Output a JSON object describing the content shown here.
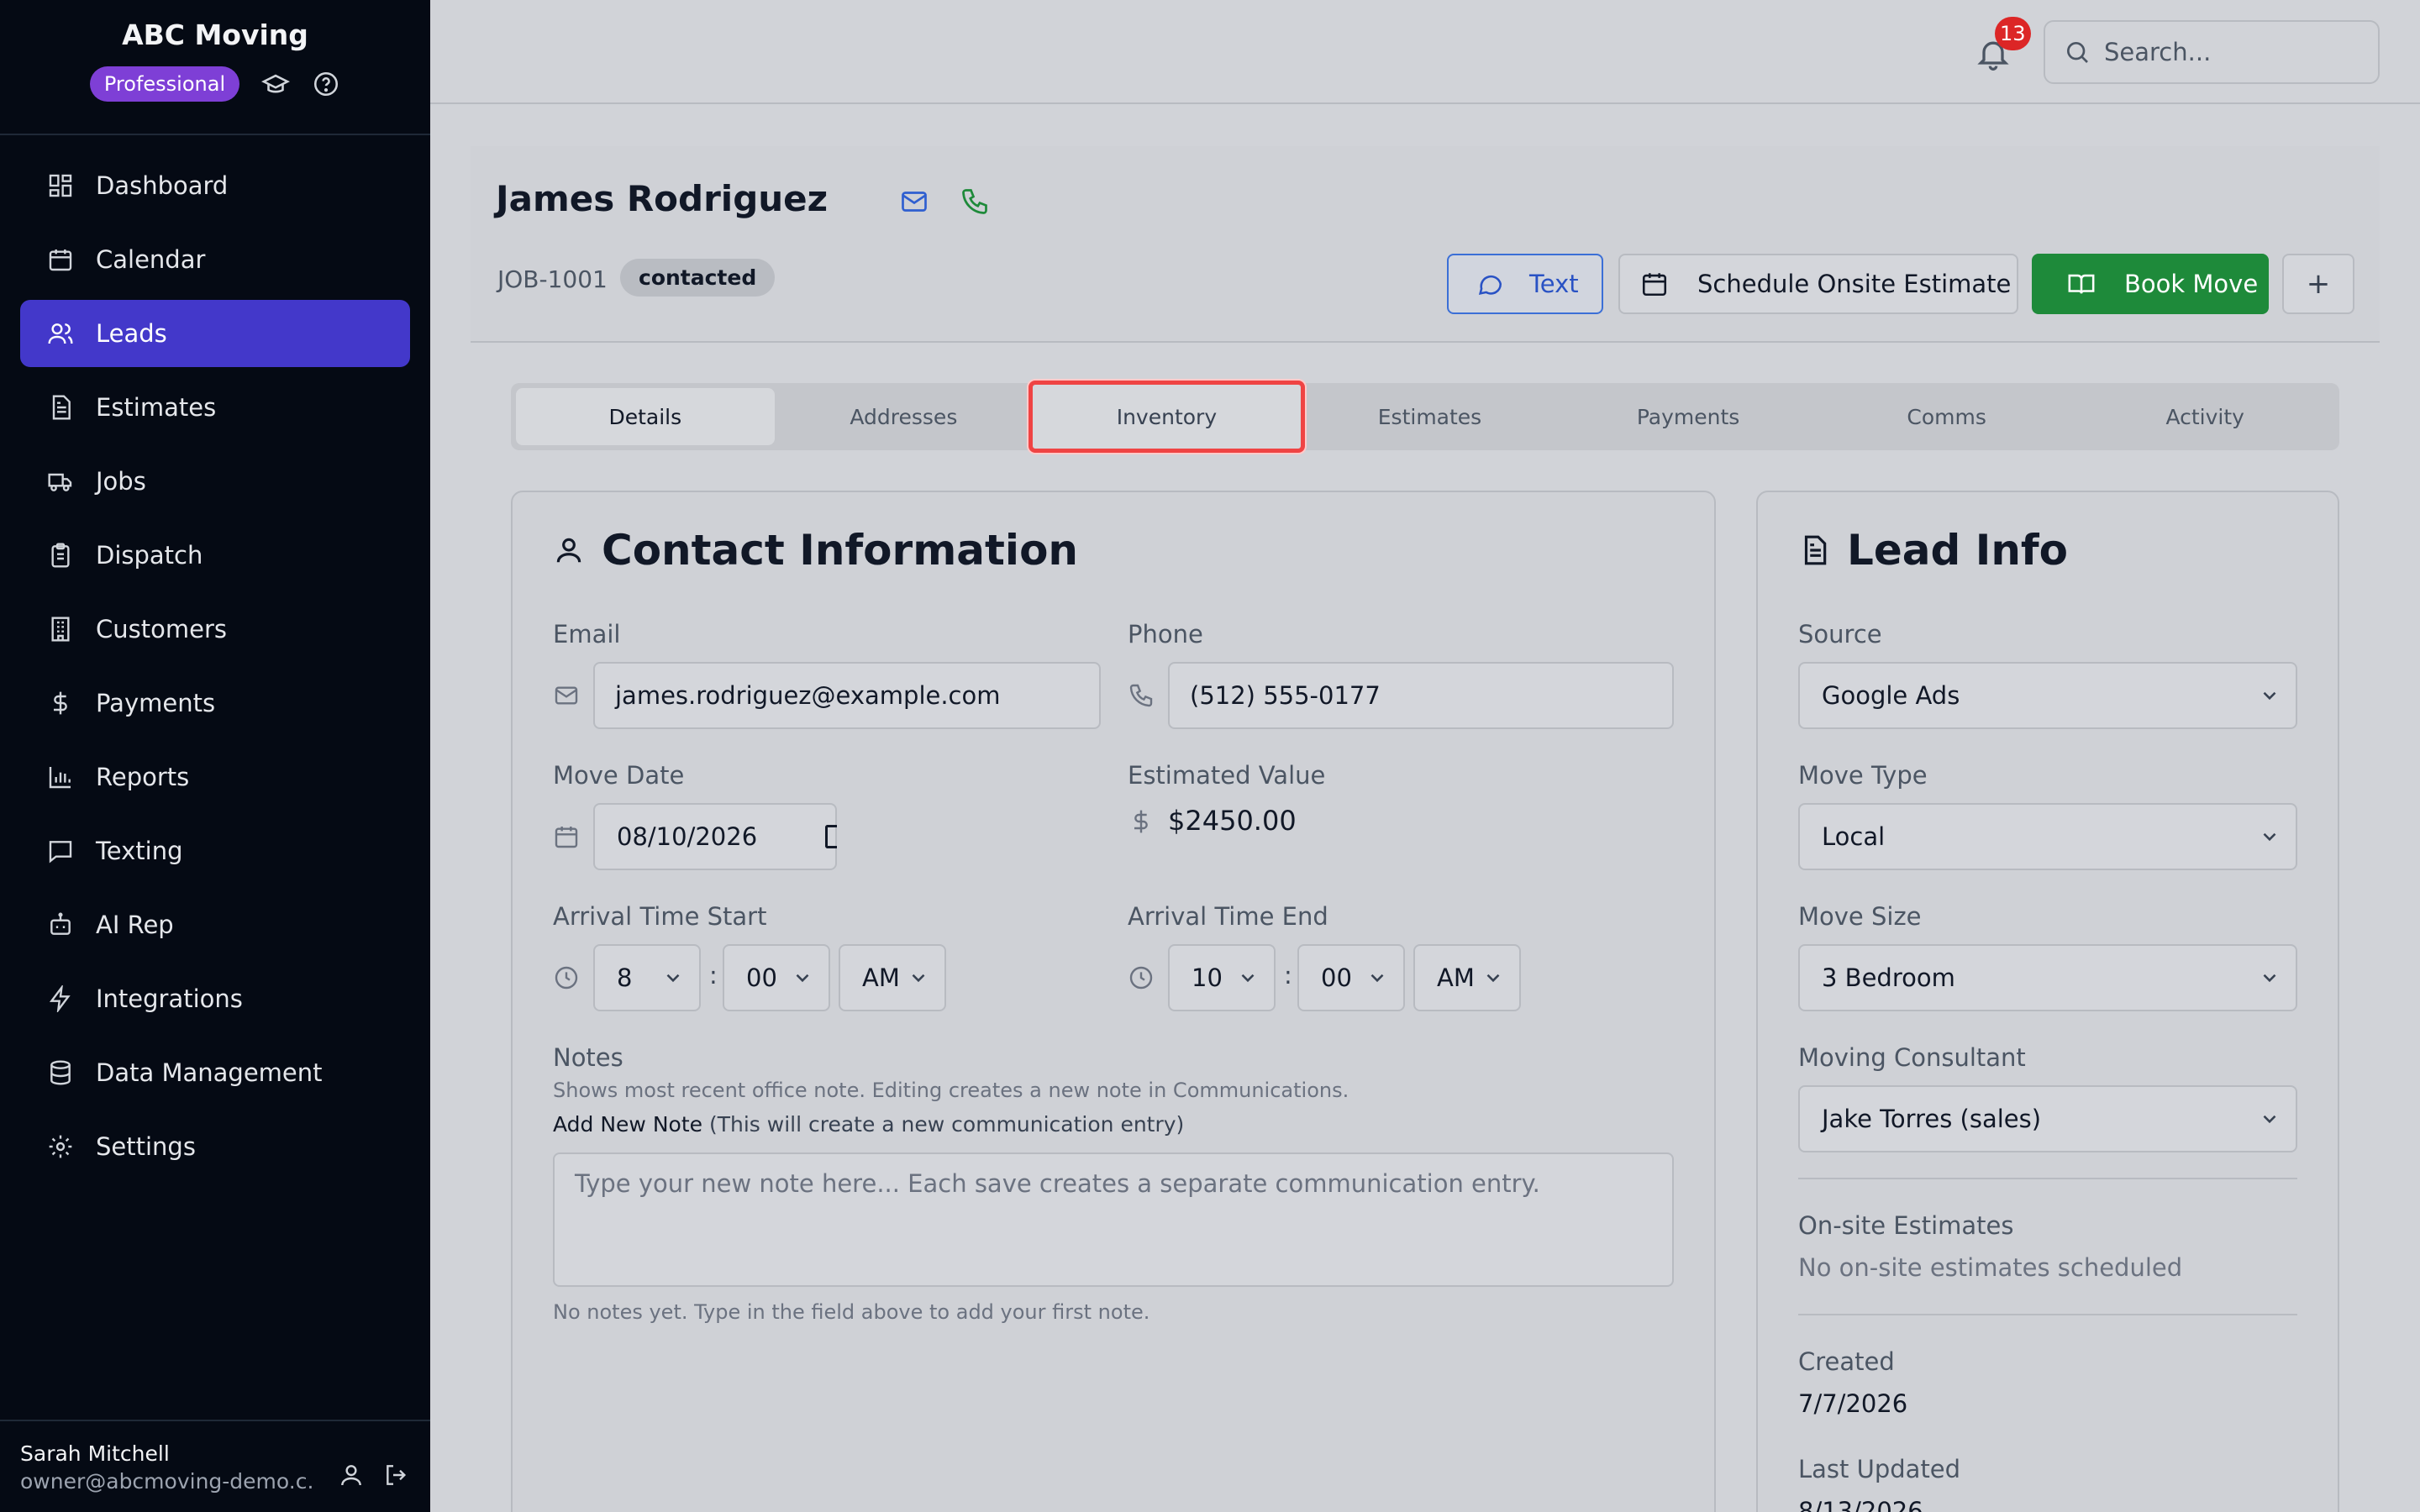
{
  "brand": {
    "name": "ABC Moving",
    "plan": "Professional"
  },
  "nav": [
    {
      "label": "Dashboard",
      "icon": "dashboard-icon"
    },
    {
      "label": "Calendar",
      "icon": "calendar-icon"
    },
    {
      "label": "Leads",
      "icon": "users-icon",
      "active": true
    },
    {
      "label": "Estimates",
      "icon": "document-icon"
    },
    {
      "label": "Jobs",
      "icon": "truck-icon"
    },
    {
      "label": "Dispatch",
      "icon": "clipboard-icon"
    },
    {
      "label": "Customers",
      "icon": "building-icon"
    },
    {
      "label": "Payments",
      "icon": "dollar-icon"
    },
    {
      "label": "Reports",
      "icon": "bar-chart-icon"
    },
    {
      "label": "Texting",
      "icon": "message-icon"
    },
    {
      "label": "AI Rep",
      "icon": "bot-icon"
    },
    {
      "label": "Integrations",
      "icon": "zap-icon"
    },
    {
      "label": "Data Management",
      "icon": "database-icon"
    },
    {
      "label": "Settings",
      "icon": "gear-icon"
    }
  ],
  "user": {
    "name": "Sarah Mitchell",
    "email": "owner@abcmoving-demo.c..."
  },
  "topbar": {
    "notifications": "13",
    "search_placeholder": "Search..."
  },
  "lead": {
    "name": "James Rodriguez",
    "job_id": "JOB-1001",
    "status": "contacted"
  },
  "actions": {
    "text": "Text",
    "schedule": "Schedule Onsite Estimate",
    "book": "Book Move",
    "plus": "+"
  },
  "tabs": [
    "Details",
    "Addresses",
    "Inventory",
    "Estimates",
    "Payments",
    "Comms",
    "Activity"
  ],
  "contact": {
    "title": "Contact Information",
    "email_label": "Email",
    "email": "james.rodriguez@example.com",
    "phone_label": "Phone",
    "phone": "(512) 555-0177",
    "move_date_label": "Move Date",
    "move_date": "08/10/2026",
    "est_value_label": "Estimated Value",
    "est_value": "$2450.00",
    "arrival_start_label": "Arrival Time Start",
    "arrival_start": {
      "hour": "8",
      "minute": "00",
      "ampm": "AM"
    },
    "arrival_end_label": "Arrival Time End",
    "arrival_end": {
      "hour": "10",
      "minute": "00",
      "ampm": "AM"
    },
    "colon": ":",
    "notes_label": "Notes",
    "notes_help": "Shows most recent office note. Editing creates a new note in Communications.",
    "add_note_label": "Add New Note",
    "add_note_hint": "(This will create a new communication entry)",
    "note_placeholder": "Type your new note here... Each save creates a separate communication entry.",
    "no_notes": "No notes yet. Type in the field above to add your first note."
  },
  "lead_info": {
    "title": "Lead Info",
    "source_label": "Source",
    "source": "Google Ads",
    "move_type_label": "Move Type",
    "move_type": "Local",
    "move_size_label": "Move Size",
    "move_size": "3 Bedroom",
    "consultant_label": "Moving Consultant",
    "consultant": "Jake Torres (sales)",
    "onsite_label": "On-site Estimates",
    "onsite_value": "No on-site estimates scheduled",
    "created_label": "Created",
    "created": "7/7/2026",
    "updated_label": "Last Updated",
    "updated": "8/13/2026"
  }
}
